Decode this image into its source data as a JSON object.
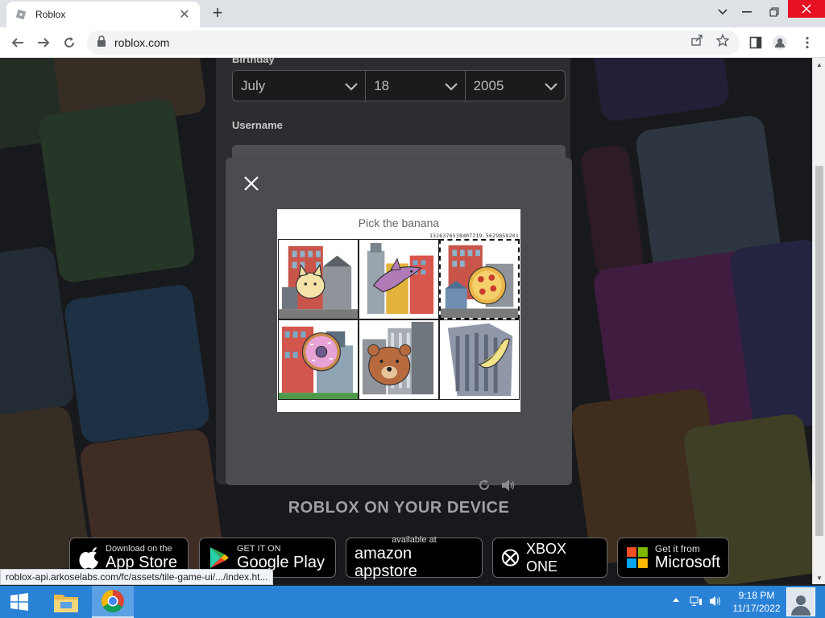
{
  "browser": {
    "tab_title": "Roblox",
    "tab_close": "✕",
    "new_tab": "+",
    "url": "roblox.com"
  },
  "page": {
    "birthday_label": "Birthday",
    "birthday": {
      "month": "July",
      "day": "18",
      "year": "2005"
    },
    "username_label": "Username",
    "device_heading": "ROBLOX ON YOUR DEVICE",
    "stores": [
      {
        "small": "Download on the",
        "big": "App Store"
      },
      {
        "small": "GET IT ON",
        "big": "Google Play"
      },
      {
        "small": "available at",
        "big": "amazon appstore"
      },
      {
        "small": "",
        "big": "XBOX ONE"
      },
      {
        "small": "Get it from",
        "big": "Microsoft"
      }
    ]
  },
  "captcha": {
    "prompt": "Pick the banana",
    "session_id": "1326376538d07219.5629859201",
    "tiles": [
      {
        "object": "cat",
        "selected": false
      },
      {
        "object": "dolphin",
        "selected": false
      },
      {
        "object": "pizza",
        "selected": true
      },
      {
        "object": "donut",
        "selected": false
      },
      {
        "object": "bear",
        "selected": false
      },
      {
        "object": "banana",
        "selected": false
      }
    ],
    "icons": {
      "reload": "reload-icon",
      "audio": "audio-icon",
      "close": "close-icon"
    }
  },
  "status_url": "roblox-api.arkoselabs.com/fc/assets/tile-game-ui/.../index.ht...",
  "taskbar": {
    "time": "9:18 PM",
    "date": "11/17/2022"
  },
  "colors": {
    "taskbar": "#2a82d6",
    "page_bg": "#232629",
    "modal": "#4a4c4f",
    "accent_close": "#e81123"
  }
}
